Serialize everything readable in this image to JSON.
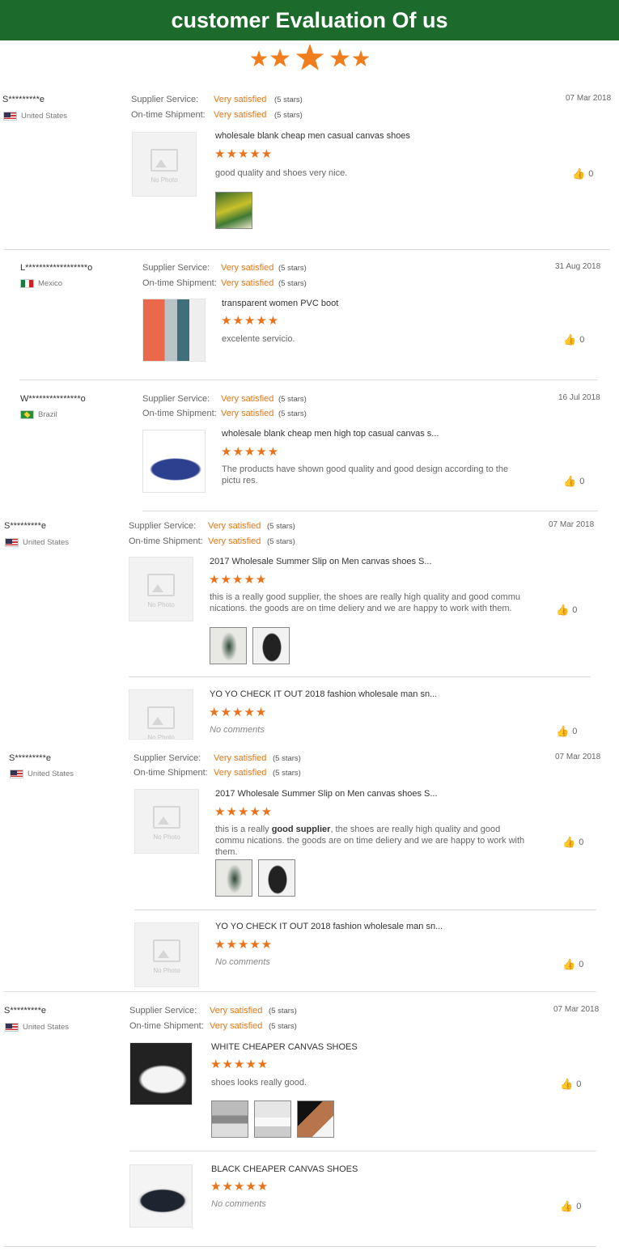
{
  "banner": {
    "title": "customer Evaluation Of us"
  },
  "top_stars_icon": "five-star-rating-icon",
  "accent_color": "#e8731c",
  "labels": {
    "supplier_service": "Supplier Service:",
    "ontime_shipment": "On-time Shipment:",
    "very_satisfied": "Very satisfied",
    "five_stars": "(5 stars)",
    "no_photo": "No Photo",
    "no_comments": "No comments",
    "star_glyphs": "★★★★★",
    "like_count": "0"
  },
  "reviews": [
    {
      "user": "S*********e",
      "country": "United States",
      "date": "07 Mar 2018",
      "products": [
        {
          "title": "wholesale blank cheap men casual canvas shoes",
          "comment": "good quality and shoes very nice."
        }
      ]
    },
    {
      "user": "L******************o",
      "country": "Mexico",
      "date": "31 Aug 2018",
      "products": [
        {
          "title": "transparent women PVC boot",
          "comment": "excelente servicio."
        }
      ]
    },
    {
      "user": "W***************o",
      "country": "Brazil",
      "date": "16 Jul 2018",
      "products": [
        {
          "title": "wholesale blank cheap men high top casual canvas s...",
          "comment": "The products have shown good quality and good design according to the pictu res."
        }
      ]
    },
    {
      "user": "S*********e",
      "country": "United States",
      "date": "07 Mar 2018",
      "products": [
        {
          "title": "2017 Wholesale Summer Slip on Men canvas shoes S...",
          "comment": "this is a really good supplier, the shoes are really high quality and good commu nications. the goods are on time deliery and we are happy to work with them."
        },
        {
          "title": "YO YO CHECK IT OUT 2018 fashion wholesale man sn...",
          "comment": "No comments"
        }
      ]
    },
    {
      "user": "S*********e",
      "country": "United States",
      "date": "07 Mar 2018",
      "products": [
        {
          "title": "2017 Wholesale Summer Slip on Men canvas shoes S...",
          "comment_pre": "this is a really ",
          "comment_bold": "good supplier",
          "comment_post": ", the shoes are really high quality and good commu nications. the goods are on time deliery and we are happy to work with them."
        },
        {
          "title": "YO YO CHECK IT OUT 2018 fashion wholesale man sn...",
          "comment": "No comments"
        }
      ]
    },
    {
      "user": "S*********e",
      "country": "United States",
      "date": "07 Mar 2018",
      "products": [
        {
          "title": "WHITE CHEAPER CANVAS SHOES",
          "comment": "shoes looks really good."
        },
        {
          "title": "BLACK CHEAPER CANVAS SHOES",
          "comment": "No comments"
        }
      ]
    }
  ]
}
